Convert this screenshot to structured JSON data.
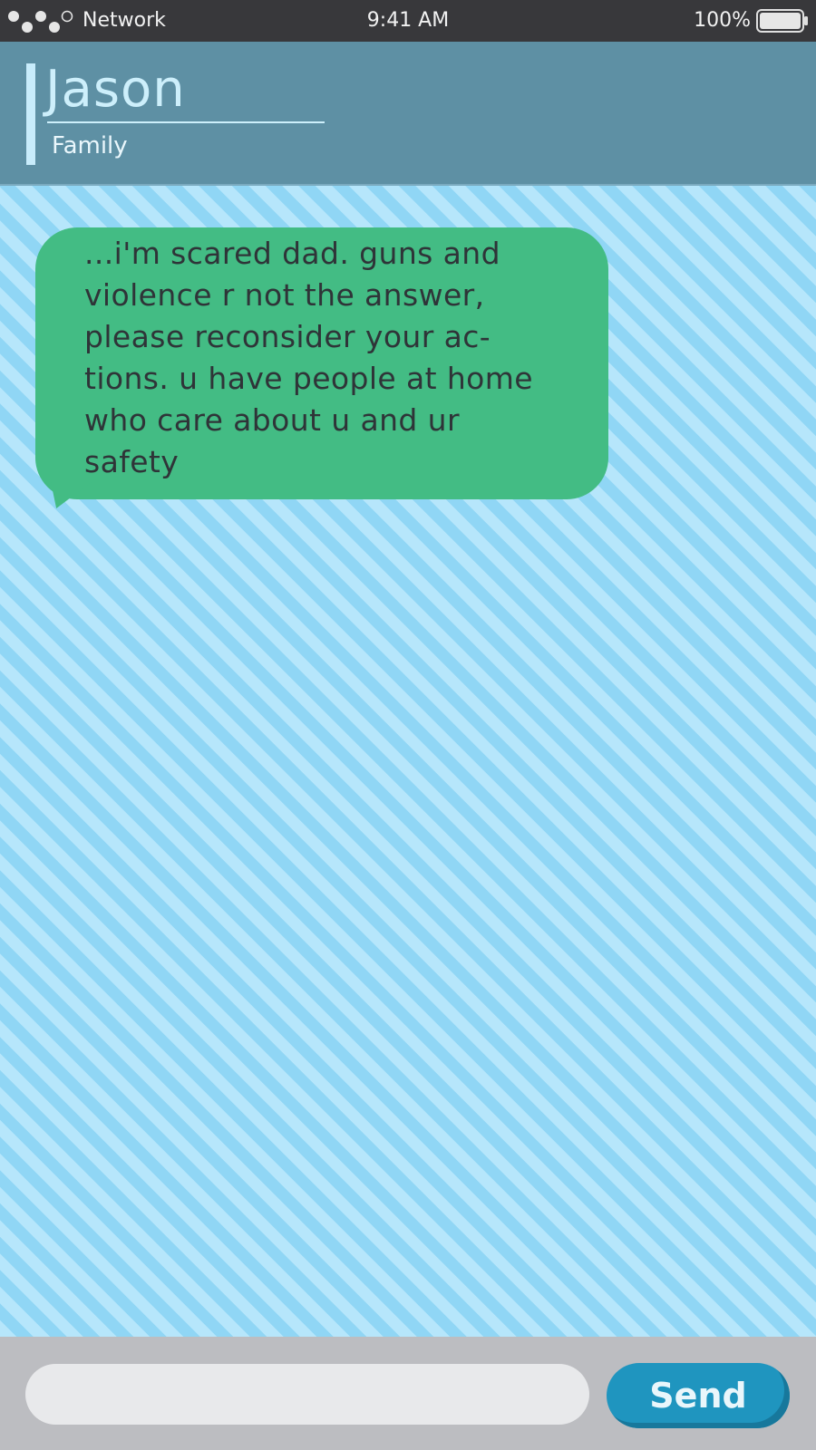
{
  "status_bar": {
    "network_label": "Network",
    "time": "9:41 AM",
    "battery_percent": "100%",
    "battery_level": 1.0,
    "signal_bars_filled": 4,
    "signal_bars_total": 5
  },
  "contact": {
    "name": "Jason",
    "group": "Family"
  },
  "messages": [
    {
      "text": "...i'm scared dad. guns and\nviolence r not the answer,\nplease reconsider your ac-\ntions. u have people at home\nwho care about u and ur\nsafety",
      "color": "#43bc84"
    }
  ],
  "composer": {
    "value": "",
    "placeholder": "",
    "send_label": "Send"
  },
  "colors": {
    "status_bar_bg": "#38383b",
    "header_bg": "#5e90a4",
    "stripe_light": "#b6e6fb",
    "stripe_dark": "#90d6f5",
    "send_button": "#1f95bf"
  }
}
